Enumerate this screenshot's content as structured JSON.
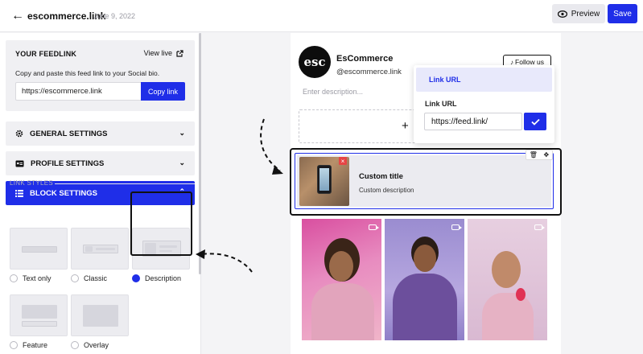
{
  "header": {
    "brand": "escommerce.link",
    "date": "June 9, 2022",
    "preview_label": "Preview",
    "save_label": "Save"
  },
  "feedlink": {
    "title": "YOUR FEEDLINK",
    "view_live": "View live",
    "description": "Copy and paste this feed link to your Social bio.",
    "url": "https://escommerce.link",
    "copy_label": "Copy link"
  },
  "sections": {
    "general": "GENERAL SETTINGS",
    "profile": "PROFILE SETTINGS",
    "block": "BLOCK SETTINGS"
  },
  "link_styles": {
    "label": "LINK STYLES",
    "options": [
      "Text only",
      "Classic",
      "Description",
      "Feature",
      "Overlay"
    ],
    "selected": "Description"
  },
  "profile": {
    "logo_text": "esc",
    "name": "EsCommerce",
    "handle": "@escommerce.link",
    "follow_label": "Follow us",
    "description_placeholder": "Enter description..."
  },
  "popup": {
    "tab_label": "Link URL",
    "field_label": "Link URL",
    "field_value": "https://feed.link/"
  },
  "block": {
    "title": "Custom title",
    "description": "Custom description"
  },
  "colors": {
    "accent": "#1f2ee8",
    "danger": "#e64545"
  }
}
